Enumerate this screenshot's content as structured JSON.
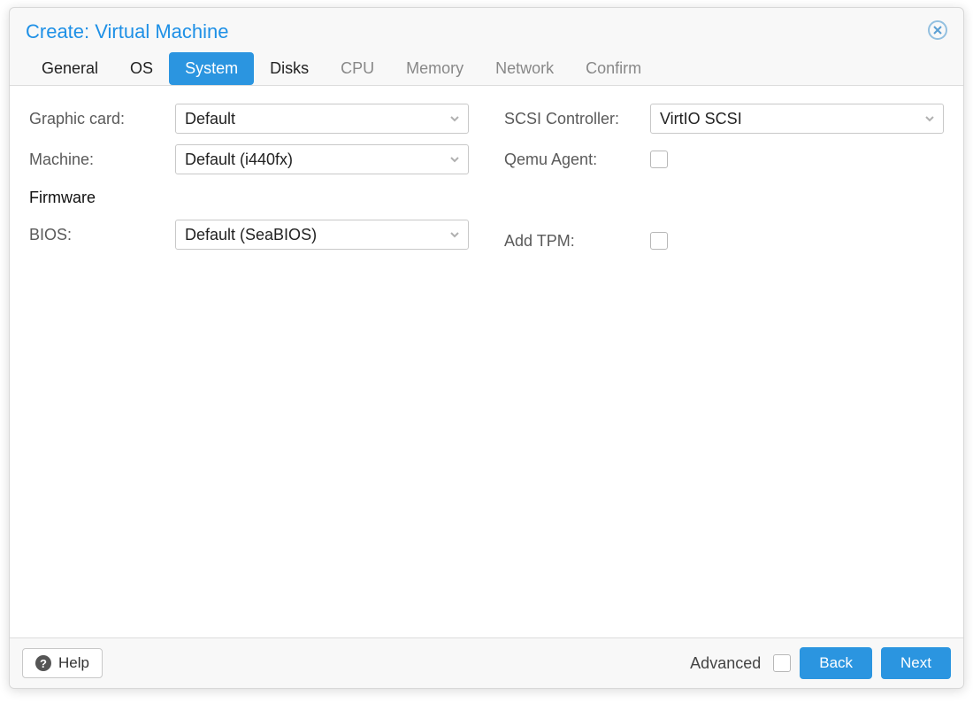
{
  "dialog": {
    "title": "Create: Virtual Machine"
  },
  "tabs": [
    {
      "label": "General",
      "enabled": true,
      "active": false
    },
    {
      "label": "OS",
      "enabled": true,
      "active": false
    },
    {
      "label": "System",
      "enabled": true,
      "active": true
    },
    {
      "label": "Disks",
      "enabled": true,
      "active": false
    },
    {
      "label": "CPU",
      "enabled": false,
      "active": false
    },
    {
      "label": "Memory",
      "enabled": false,
      "active": false
    },
    {
      "label": "Network",
      "enabled": false,
      "active": false
    },
    {
      "label": "Confirm",
      "enabled": false,
      "active": false
    }
  ],
  "left": {
    "graphic_card": {
      "label": "Graphic card:",
      "value": "Default"
    },
    "machine": {
      "label": "Machine:",
      "value": "Default (i440fx)"
    },
    "firmware_section": "Firmware",
    "bios": {
      "label": "BIOS:",
      "value": "Default (SeaBIOS)"
    }
  },
  "right": {
    "scsi_controller": {
      "label": "SCSI Controller:",
      "value": "VirtIO SCSI"
    },
    "qemu_agent": {
      "label": "Qemu Agent:",
      "checked": false
    },
    "add_tpm": {
      "label": "Add TPM:",
      "checked": false
    }
  },
  "footer": {
    "help": "Help",
    "advanced": "Advanced",
    "back": "Back",
    "next": "Next"
  }
}
